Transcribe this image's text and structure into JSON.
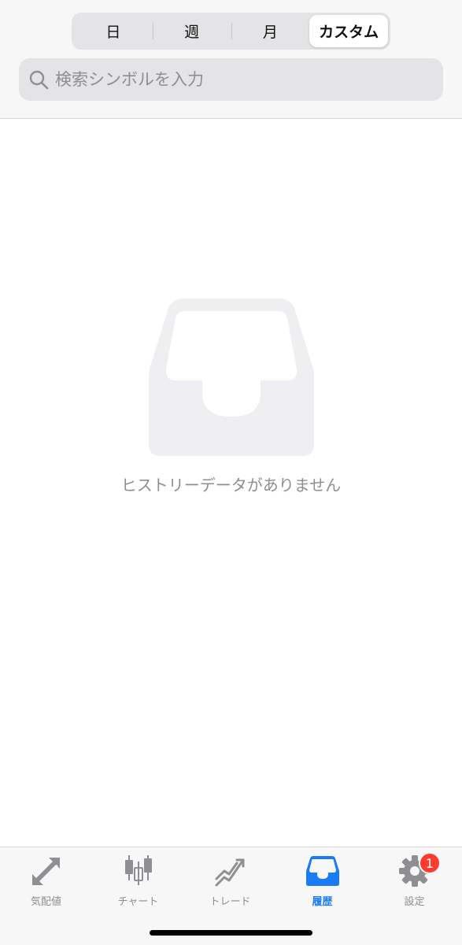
{
  "period_tabs": [
    {
      "label": "日",
      "active": false
    },
    {
      "label": "週",
      "active": false
    },
    {
      "label": "月",
      "active": false
    },
    {
      "label": "カスタム",
      "active": true
    }
  ],
  "search": {
    "placeholder": "検索シンボルを入力",
    "value": ""
  },
  "empty_state": {
    "icon": "inbox-tray-icon",
    "message": "ヒストリーデータがありません"
  },
  "tab_bar": {
    "items": [
      {
        "label": "気配値",
        "icon": "quotes-arrows-icon",
        "active": false
      },
      {
        "label": "チャート",
        "icon": "candlestick-chart-icon",
        "active": false
      },
      {
        "label": "トレード",
        "icon": "trade-trend-icon",
        "active": false
      },
      {
        "label": "履歴",
        "icon": "history-inbox-icon",
        "active": true
      },
      {
        "label": "設定",
        "icon": "gear-icon",
        "active": false,
        "badge": "1"
      }
    ]
  },
  "colors": {
    "accent": "#1a7cf5",
    "inactive": "#8e8e93",
    "badge": "#ff3b30",
    "empty_icon": "#efeff1"
  }
}
